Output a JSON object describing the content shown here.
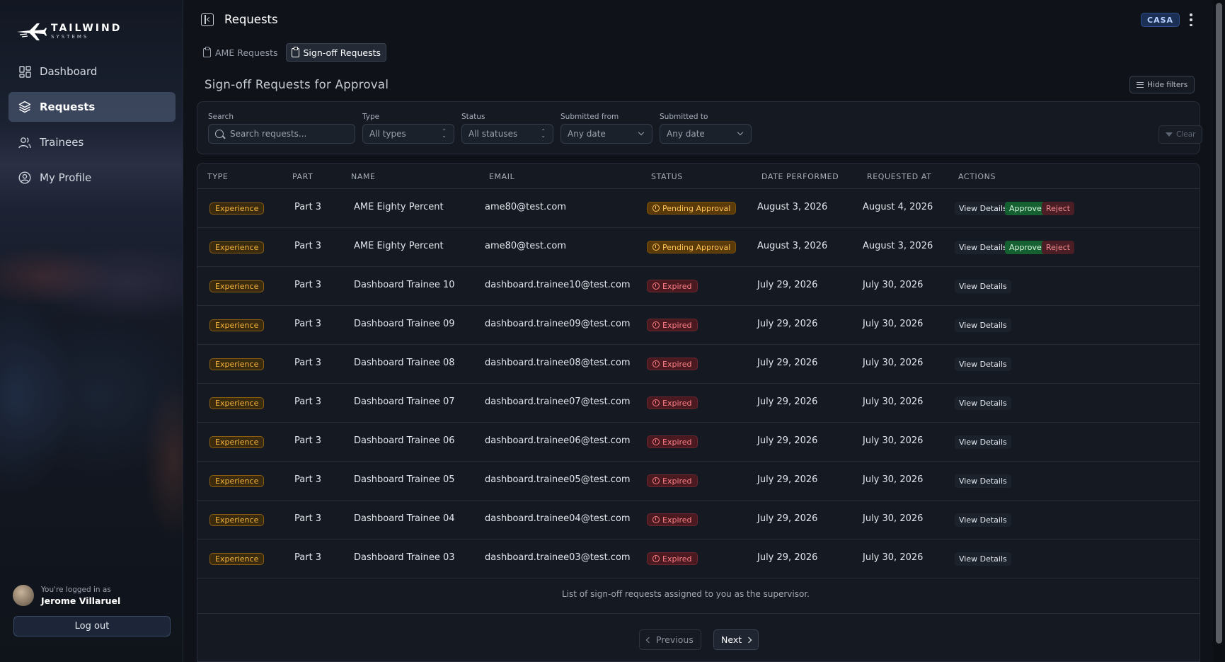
{
  "brand": {
    "name": "TAILWIND",
    "sub": "SYSTEMS"
  },
  "sidebar": {
    "items": [
      {
        "label": "Dashboard",
        "icon": "dashboard-grid-icon",
        "active": false
      },
      {
        "label": "Requests",
        "icon": "layers-icon",
        "active": true
      },
      {
        "label": "Trainees",
        "icon": "users-icon",
        "active": false
      },
      {
        "label": "My Profile",
        "icon": "user-circle-icon",
        "active": false
      }
    ],
    "user": {
      "caption": "You're logged in as",
      "name": "Jerome Villaruel"
    },
    "logout_label": "Log out"
  },
  "header": {
    "title": "Requests",
    "badge": "CASA"
  },
  "tabs": [
    {
      "label": "AME Requests",
      "active": false
    },
    {
      "label": "Sign-off Requests",
      "active": true
    }
  ],
  "section": {
    "title": "Sign-off Requests for Approval",
    "hide_filters_label": "Hide filters"
  },
  "filters": {
    "search": {
      "label": "Search",
      "placeholder": "Search requests..."
    },
    "type": {
      "label": "Type",
      "value": "All types"
    },
    "status": {
      "label": "Status",
      "value": "All statuses"
    },
    "submitted_from": {
      "label": "Submitted from",
      "value": "Any date"
    },
    "submitted_to": {
      "label": "Submitted to",
      "value": "Any date"
    },
    "clear_label": "Clear"
  },
  "table": {
    "columns": [
      "TYPE",
      "PART",
      "NAME",
      "EMAIL",
      "STATUS",
      "DATE PERFORMED",
      "REQUESTED AT",
      "ACTIONS"
    ],
    "rows": [
      {
        "type": "Experience",
        "part": "Part 3",
        "name": "AME Eighty Percent",
        "email": "ame80@test.com",
        "status": "Pending Approval",
        "date_performed": "August 3, 2026",
        "requested_at": "August 4, 2026",
        "actions": [
          "View Details",
          "Approve",
          "Reject"
        ]
      },
      {
        "type": "Experience",
        "part": "Part 3",
        "name": "AME Eighty Percent",
        "email": "ame80@test.com",
        "status": "Pending Approval",
        "date_performed": "August 3, 2026",
        "requested_at": "August 3, 2026",
        "actions": [
          "View Details",
          "Approve",
          "Reject"
        ]
      },
      {
        "type": "Experience",
        "part": "Part 3",
        "name": "Dashboard Trainee 10",
        "email": "dashboard.trainee10@test.com",
        "status": "Expired",
        "date_performed": "July 29, 2026",
        "requested_at": "July 30, 2026",
        "actions": [
          "View Details"
        ]
      },
      {
        "type": "Experience",
        "part": "Part 3",
        "name": "Dashboard Trainee 09",
        "email": "dashboard.trainee09@test.com",
        "status": "Expired",
        "date_performed": "July 29, 2026",
        "requested_at": "July 30, 2026",
        "actions": [
          "View Details"
        ]
      },
      {
        "type": "Experience",
        "part": "Part 3",
        "name": "Dashboard Trainee 08",
        "email": "dashboard.trainee08@test.com",
        "status": "Expired",
        "date_performed": "July 29, 2026",
        "requested_at": "July 30, 2026",
        "actions": [
          "View Details"
        ]
      },
      {
        "type": "Experience",
        "part": "Part 3",
        "name": "Dashboard Trainee 07",
        "email": "dashboard.trainee07@test.com",
        "status": "Expired",
        "date_performed": "July 29, 2026",
        "requested_at": "July 30, 2026",
        "actions": [
          "View Details"
        ]
      },
      {
        "type": "Experience",
        "part": "Part 3",
        "name": "Dashboard Trainee 06",
        "email": "dashboard.trainee06@test.com",
        "status": "Expired",
        "date_performed": "July 29, 2026",
        "requested_at": "July 30, 2026",
        "actions": [
          "View Details"
        ]
      },
      {
        "type": "Experience",
        "part": "Part 3",
        "name": "Dashboard Trainee 05",
        "email": "dashboard.trainee05@test.com",
        "status": "Expired",
        "date_performed": "July 29, 2026",
        "requested_at": "July 30, 2026",
        "actions": [
          "View Details"
        ]
      },
      {
        "type": "Experience",
        "part": "Part 3",
        "name": "Dashboard Trainee 04",
        "email": "dashboard.trainee04@test.com",
        "status": "Expired",
        "date_performed": "July 29, 2026",
        "requested_at": "July 30, 2026",
        "actions": [
          "View Details"
        ]
      },
      {
        "type": "Experience",
        "part": "Part 3",
        "name": "Dashboard Trainee 03",
        "email": "dashboard.trainee03@test.com",
        "status": "Expired",
        "date_performed": "July 29, 2026",
        "requested_at": "July 30, 2026",
        "actions": [
          "View Details"
        ]
      }
    ],
    "footer_note": "List of sign-off requests assigned to you as the supervisor."
  },
  "pagination": {
    "previous_label": "Previous",
    "next_label": "Next"
  },
  "colors": {
    "accent": "#5b7fbf",
    "type_badge": "#f4b43c",
    "pending": "#ffc457",
    "expired": "#ff7f86",
    "approve": "#156030",
    "reject": "#4a1e24"
  }
}
